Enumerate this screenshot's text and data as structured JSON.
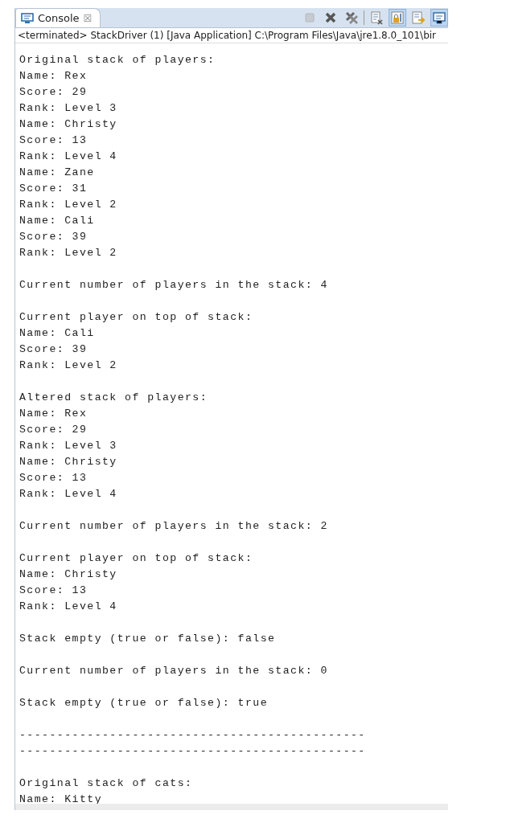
{
  "tab": {
    "title": "Console",
    "close": "☒"
  },
  "toolbar": [
    {
      "kind": "stop",
      "disabled": true,
      "selected": false
    },
    {
      "kind": "remove",
      "disabled": false,
      "selected": false
    },
    {
      "kind": "remove-all",
      "disabled": false,
      "selected": false
    },
    {
      "kind": "clear",
      "disabled": false,
      "selected": false
    },
    {
      "kind": "scroll-lock",
      "disabled": false,
      "selected": true
    },
    {
      "kind": "show-output",
      "disabled": false,
      "selected": false
    },
    {
      "kind": "console",
      "disabled": false,
      "selected": true
    }
  ],
  "status": "<terminated> StackDriver (1) [Java Application] C:\\Program Files\\Java\\jre1.8.0_101\\bir",
  "console": {
    "blocks": [
      [
        "Original stack of players:",
        "Name: Rex",
        "Score: 29",
        "Rank: Level 3",
        "Name: Christy",
        "Score: 13",
        "Rank: Level 4",
        "Name: Zane",
        "Score: 31",
        "Rank: Level 2",
        "Name: Cali",
        "Score: 39",
        "Rank: Level 2"
      ],
      [
        "Current number of players in the stack: 4"
      ],
      [
        "Current player on top of stack:",
        "Name: Cali",
        "Score: 39",
        "Rank: Level 2"
      ],
      [
        "Altered stack of players:",
        "Name: Rex",
        "Score: 29",
        "Rank: Level 3",
        "Name: Christy",
        "Score: 13",
        "Rank: Level 4"
      ],
      [
        "Current number of players in the stack: 2"
      ],
      [
        "Current player on top of stack:",
        "Name: Christy",
        "Score: 13",
        "Rank: Level 4"
      ],
      [
        "Stack empty (true or false): false"
      ],
      [
        "Current number of players in the stack: 0"
      ],
      [
        "Stack empty (true or false): true"
      ],
      [
        "----------------------------------------------",
        "----------------------------------------------"
      ],
      [
        "Original stack of cats:",
        "Name: Kitty"
      ]
    ]
  }
}
